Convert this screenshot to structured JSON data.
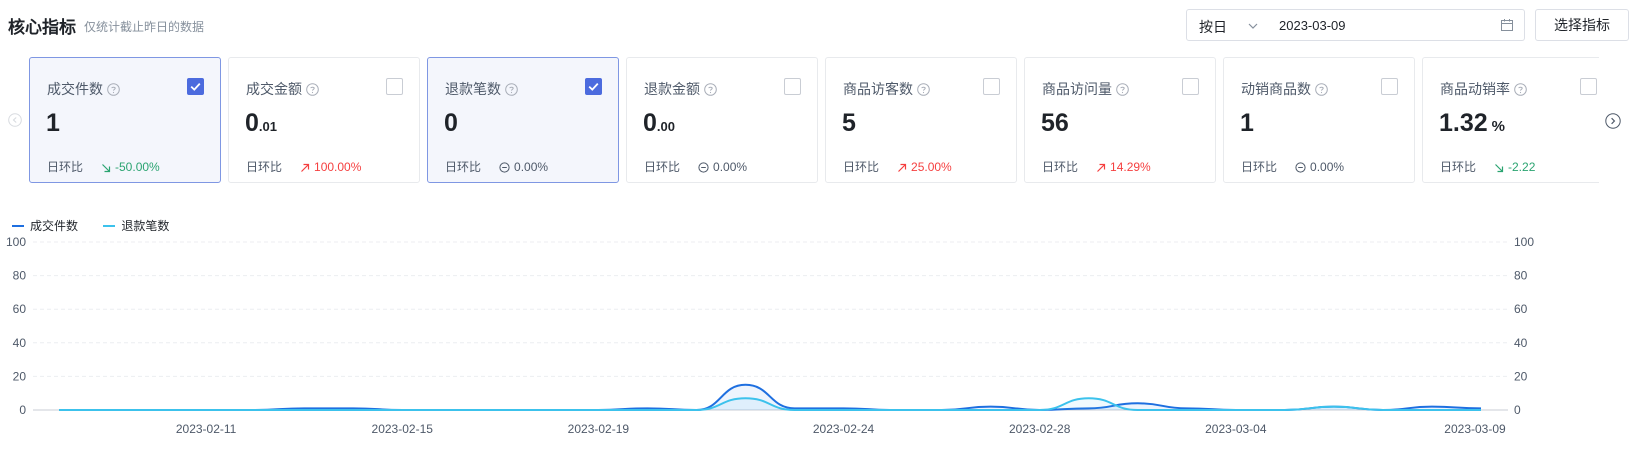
{
  "header": {
    "title": "核心指标",
    "subtitle": "仅统计截止昨日的数据",
    "period_select": "按日",
    "date_value": "2023-03-09",
    "select_metrics_button": "选择指标"
  },
  "compare_label": "日环比",
  "cards": [
    {
      "name": "成交件数",
      "selected": true,
      "value_main": "1",
      "value_small": "",
      "unit": "",
      "trend": "down",
      "change": "-50.00%"
    },
    {
      "name": "成交金额",
      "selected": false,
      "value_main": "0",
      "value_small": ".01",
      "unit": "",
      "trend": "up",
      "change": "100.00%"
    },
    {
      "name": "退款笔数",
      "selected": true,
      "value_main": "0",
      "value_small": "",
      "unit": "",
      "trend": "flat",
      "change": "0.00%"
    },
    {
      "name": "退款金额",
      "selected": false,
      "value_main": "0",
      "value_small": ".00",
      "unit": "",
      "trend": "flat",
      "change": "0.00%"
    },
    {
      "name": "商品访客数",
      "selected": false,
      "value_main": "5",
      "value_small": "",
      "unit": "",
      "trend": "up",
      "change": "25.00%"
    },
    {
      "name": "商品访问量",
      "selected": false,
      "value_main": "56",
      "value_small": "",
      "unit": "",
      "trend": "up",
      "change": "14.29%"
    },
    {
      "name": "动销商品数",
      "selected": false,
      "value_main": "1",
      "value_small": "",
      "unit": "",
      "trend": "flat",
      "change": "0.00%"
    },
    {
      "name": "商品动销率",
      "selected": false,
      "value_main": "1.32",
      "value_small": "",
      "unit": "%",
      "trend": "down",
      "change": "-2.22"
    }
  ],
  "colors": {
    "series_1": "#1e6fe0",
    "series_2": "#3cc2ec",
    "selected_border": "#7f97e3",
    "checkbox": "#4c6bde",
    "up": "#f53f3f",
    "down": "#2ba471"
  },
  "chart_data": {
    "type": "line",
    "legend_position": "top-left",
    "grid": true,
    "ylim": [
      0,
      100
    ],
    "y_ticks": [
      "0",
      "20",
      "40",
      "60",
      "80",
      "100"
    ],
    "x_tick_labels": [
      "2023-02-11",
      "2023-02-15",
      "2023-02-19",
      "2023-02-24",
      "2023-02-28",
      "2023-03-04",
      "2023-03-09"
    ],
    "x": [
      "2023-02-08",
      "2023-02-09",
      "2023-02-10",
      "2023-02-11",
      "2023-02-12",
      "2023-02-13",
      "2023-02-14",
      "2023-02-15",
      "2023-02-16",
      "2023-02-17",
      "2023-02-18",
      "2023-02-19",
      "2023-02-20",
      "2023-02-21",
      "2023-02-22",
      "2023-02-23",
      "2023-02-24",
      "2023-02-25",
      "2023-02-26",
      "2023-02-27",
      "2023-02-28",
      "2023-03-01",
      "2023-03-02",
      "2023-03-03",
      "2023-03-04",
      "2023-03-05",
      "2023-03-06",
      "2023-03-07",
      "2023-03-08",
      "2023-03-09"
    ],
    "series": [
      {
        "name": "成交件数",
        "values": [
          0,
          0,
          0,
          0,
          0,
          1,
          1,
          0,
          0,
          0,
          0,
          0,
          1,
          0,
          15,
          1,
          1,
          0,
          0,
          2,
          0,
          1,
          4,
          1,
          0,
          0,
          2,
          0,
          2,
          1
        ]
      },
      {
        "name": "退款笔数",
        "values": [
          0,
          0,
          0,
          0,
          0,
          0,
          0,
          0,
          0,
          0,
          0,
          0,
          0,
          0,
          7,
          0,
          0,
          0,
          0,
          0,
          0,
          7,
          0,
          0,
          0,
          0,
          2,
          0,
          0,
          0
        ]
      }
    ]
  }
}
